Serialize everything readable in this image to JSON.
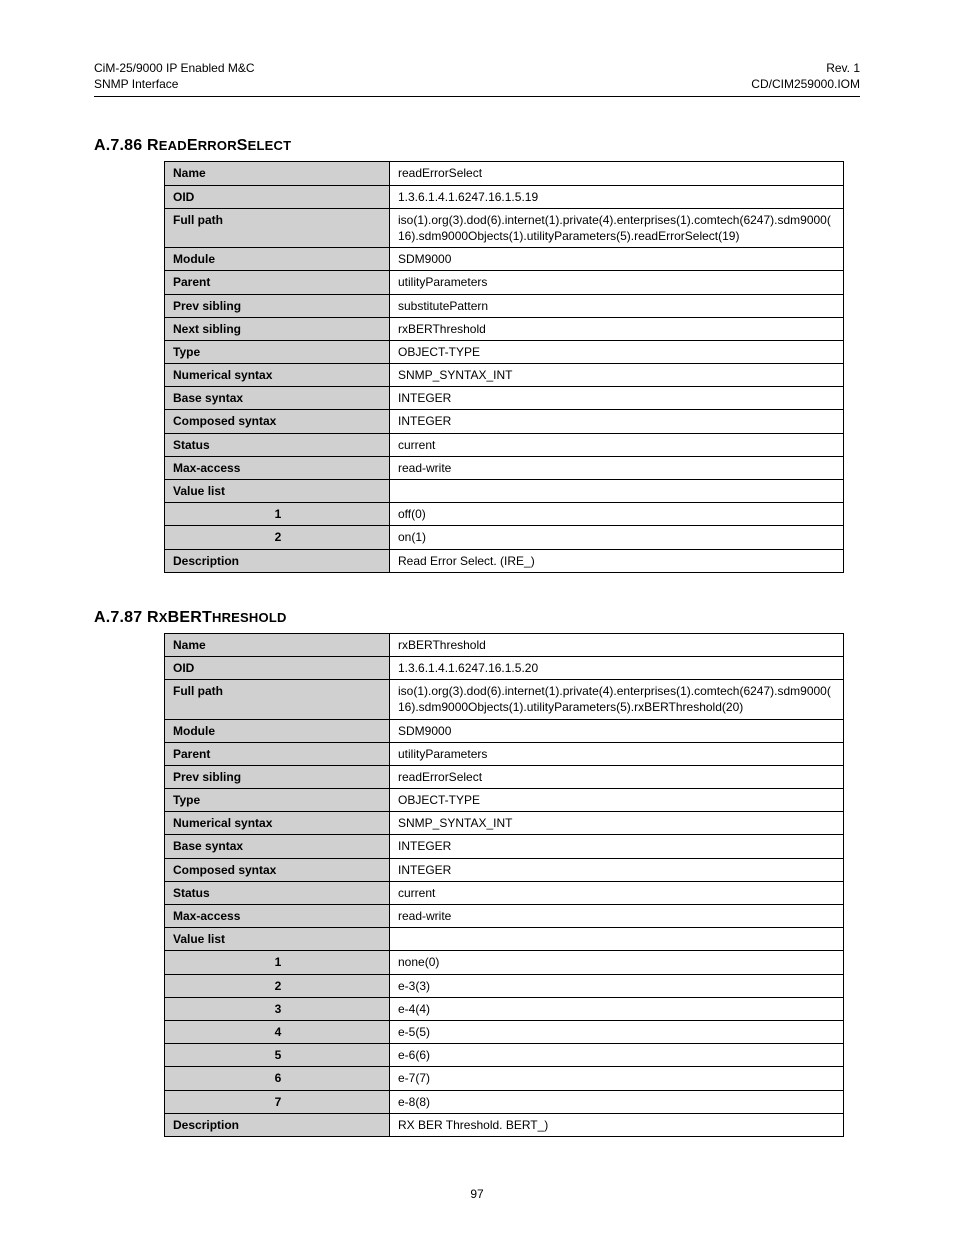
{
  "header": {
    "left_line1": "CiM-25/9000 IP Enabled M&C",
    "left_line2": "SNMP Interface",
    "right_line1": "Rev. 1",
    "right_line2": "CD/CIM259000.IOM"
  },
  "section1": {
    "number": "A.7.86",
    "title_lead1": "R",
    "title_rest1": "ead",
    "title_lead2": "E",
    "title_rest2": "rror",
    "title_lead3": "S",
    "title_rest3": "elect",
    "rows": [
      {
        "label": "Name",
        "value": "readErrorSelect"
      },
      {
        "label": "OID",
        "value": "1.3.6.1.4.1.6247.16.1.5.19"
      },
      {
        "label": "Full path",
        "value": "iso(1).org(3).dod(6).internet(1).private(4).enterprises(1).comtech(6247).sdm9000(16).sdm9000Objects(1).utilityParameters(5).readErrorSelect(19)"
      },
      {
        "label": "Module",
        "value": "SDM9000"
      },
      {
        "label": "Parent",
        "value": "utilityParameters"
      },
      {
        "label": "Prev sibling",
        "value": "substitutePattern"
      },
      {
        "label": "Next sibling",
        "value": "rxBERThreshold"
      },
      {
        "label": "Type",
        "value": "OBJECT-TYPE"
      },
      {
        "label": "Numerical syntax",
        "value": "SNMP_SYNTAX_INT"
      },
      {
        "label": "Base syntax",
        "value": "INTEGER"
      },
      {
        "label": "Composed syntax",
        "value": "INTEGER"
      },
      {
        "label": "Status",
        "value": "current"
      },
      {
        "label": "Max-access",
        "value": "read-write"
      },
      {
        "label": "Value list",
        "value": ""
      },
      {
        "label": "1",
        "value": "off(0)",
        "indent": true
      },
      {
        "label": "2",
        "value": "on(1)",
        "indent": true
      },
      {
        "label": "Description",
        "value": "Read Error Select.  (IRE_)"
      }
    ]
  },
  "section2": {
    "number": "A.7.87",
    "title_lead1": "R",
    "title_rest1": "x",
    "title_lead2": "BERT",
    "title_rest2": "hreshold",
    "rows": [
      {
        "label": "Name",
        "value": "rxBERThreshold"
      },
      {
        "label": "OID",
        "value": "1.3.6.1.4.1.6247.16.1.5.20"
      },
      {
        "label": "Full path",
        "value": "iso(1).org(3).dod(6).internet(1).private(4).enterprises(1).comtech(6247).sdm9000(16).sdm9000Objects(1).utilityParameters(5).rxBERThreshold(20)"
      },
      {
        "label": "Module",
        "value": "SDM9000"
      },
      {
        "label": "Parent",
        "value": "utilityParameters"
      },
      {
        "label": "Prev sibling",
        "value": "readErrorSelect"
      },
      {
        "label": "Type",
        "value": "OBJECT-TYPE"
      },
      {
        "label": "Numerical syntax",
        "value": "SNMP_SYNTAX_INT"
      },
      {
        "label": "Base syntax",
        "value": "INTEGER"
      },
      {
        "label": "Composed syntax",
        "value": "INTEGER"
      },
      {
        "label": "Status",
        "value": "current"
      },
      {
        "label": "Max-access",
        "value": "read-write"
      },
      {
        "label": "Value list",
        "value": ""
      },
      {
        "label": "1",
        "value": "none(0)",
        "indent": true
      },
      {
        "label": "2",
        "value": "e-3(3)",
        "indent": true
      },
      {
        "label": "3",
        "value": "e-4(4)",
        "indent": true
      },
      {
        "label": "4",
        "value": "e-5(5)",
        "indent": true
      },
      {
        "label": "5",
        "value": "e-6(6)",
        "indent": true
      },
      {
        "label": "6",
        "value": "e-7(7)",
        "indent": true
      },
      {
        "label": "7",
        "value": "e-8(8)",
        "indent": true
      },
      {
        "label": "Description",
        "value": "RX BER Threshold.  BERT_)"
      }
    ]
  },
  "page_number": "97"
}
